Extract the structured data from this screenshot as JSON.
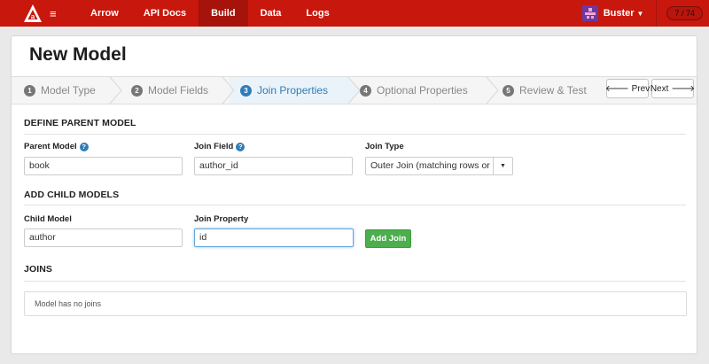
{
  "nav": {
    "items": [
      {
        "label": "Arrow"
      },
      {
        "label": "API Docs"
      },
      {
        "label": "Build"
      },
      {
        "label": "Data"
      },
      {
        "label": "Logs"
      }
    ],
    "active": "Build",
    "user": "Buster",
    "counter": "7 / 74",
    "brand_color": "#c8170d"
  },
  "page": {
    "title": "New Model"
  },
  "wizard": {
    "steps": [
      {
        "num": "1",
        "label": "Model Type"
      },
      {
        "num": "2",
        "label": "Model Fields"
      },
      {
        "num": "3",
        "label": "Join Properties"
      },
      {
        "num": "4",
        "label": "Optional Properties"
      },
      {
        "num": "5",
        "label": "Review & Test"
      }
    ],
    "active_step": 3,
    "prev_label": "Prev",
    "next_label": "Next"
  },
  "parent": {
    "heading": "DEFINE PARENT MODEL",
    "parent_model_label": "Parent Model",
    "parent_model_value": "book",
    "join_field_label": "Join Field",
    "join_field_value": "author_id",
    "join_type_label": "Join Type",
    "join_type_value": "Outer Join (matching rows or"
  },
  "child": {
    "heading": "ADD CHILD MODELS",
    "child_model_label": "Child Model",
    "child_model_value": "author",
    "join_property_label": "Join Property",
    "join_property_value": "id",
    "add_join_label": "Add Join"
  },
  "joins": {
    "heading": "JOINS",
    "empty_text": "Model has no joins"
  },
  "colors": {
    "accent_blue": "#2f7db7",
    "green": "#4cae4c"
  }
}
